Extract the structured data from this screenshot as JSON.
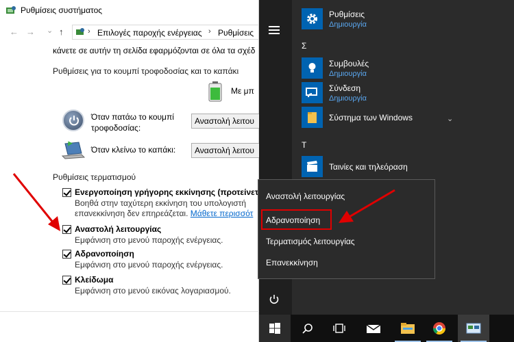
{
  "window": {
    "title": "Ρυθμίσεις συστήματος",
    "nav": {
      "back": "←",
      "forward": "→",
      "dropdown": "⌄",
      "up": "↑"
    },
    "breadcrumb": [
      "Επιλογές παροχής ενέργειας",
      "Ρυθμίσεις"
    ]
  },
  "panel": {
    "intro_text": "κάνετε σε αυτήν τη σελίδα εφαρμόζονται σε όλα τα σχέδ",
    "section_buttons": "Ρυθμίσεις για το κουμπί τροφοδοσίας και το καπάκι",
    "column_header": "Με μπ",
    "power_button_label_1": "Όταν πατάω το κουμπί",
    "power_button_label_2": "τροφοδοσίας:",
    "power_button_value": "Αναστολή λειτου",
    "lid_label": "Όταν κλείνω το καπάκι:",
    "lid_value": "Αναστολή λειτου",
    "section_shutdown": "Ρυθμίσεις τερματισμού",
    "options": [
      {
        "title": "Ενεργοποίηση γρήγορης εκκίνησης (προτείνετ",
        "desc_1": "Βοηθά στην ταχύτερη εκκίνηση του υπολογιστή",
        "desc_2": "επανεκκίνηση δεν επηρεάζεται.",
        "link": "Μάθετε περισσότ",
        "checked": true
      },
      {
        "title": "Αναστολή λειτουργίας",
        "desc": "Εμφάνιση στο μενού παροχής ενέργειας.",
        "checked": true
      },
      {
        "title": "Αδρανοποίηση",
        "desc": "Εμφάνιση στο μενού παροχής ενέργειας.",
        "checked": true
      },
      {
        "title": "Κλείδωμα",
        "desc": "Εμφάνιση στο μενού εικόνας λογαριασμού.",
        "checked": true
      }
    ]
  },
  "start_menu": {
    "apps": [
      {
        "name": "Ρυθμίσεις",
        "sub": "Δημιουργία",
        "icon": "gear-icon"
      },
      {
        "name": "Συμβουλές",
        "sub": "Δημιουργία",
        "icon": "lightbulb-icon"
      },
      {
        "name": "Σύνδεση",
        "sub": "Δημιουργία",
        "icon": "connect-icon"
      },
      {
        "name": "Σύστημα των Windows",
        "sub": "",
        "icon": "folder-icon"
      },
      {
        "name": "Ταινίες και τηλεόραση",
        "sub": "",
        "icon": "clapperboard-icon"
      }
    ],
    "letters": [
      "Σ",
      "Τ"
    ],
    "power_menu": [
      "Αναστολή λειτουργίας",
      "Αδρανοποίηση",
      "Τερματισμός λειτουργίας",
      "Επανεκκίνηση"
    ],
    "highlighted": "Αδρανοποίηση"
  },
  "taskbar": {
    "icons": [
      "windows-logo-icon",
      "search-icon",
      "task-view-icon",
      "mail-icon",
      "file-explorer-icon",
      "chrome-icon",
      "control-panel-icon"
    ]
  },
  "colors": {
    "tile_blue": "#0063b1",
    "link_blue": "#0066cc",
    "start_bg": "#2b2b2b",
    "highlight_red": "#e00000",
    "sub_blue": "#5aa7f0"
  }
}
